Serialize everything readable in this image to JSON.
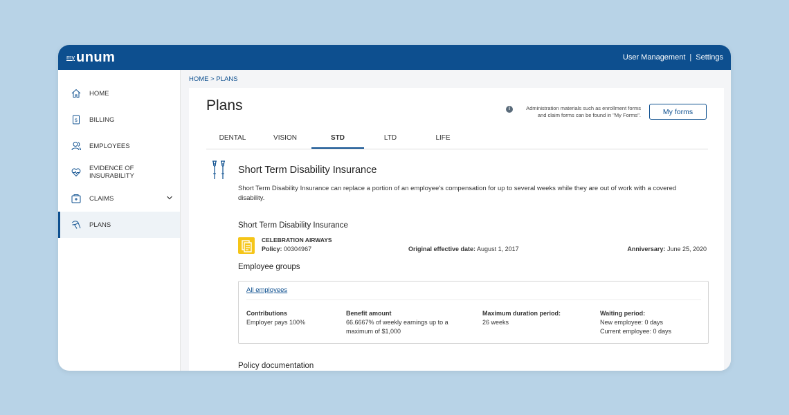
{
  "header": {
    "logo_prefix": "my",
    "logo_brand": "unum",
    "nav_user_management": "User Management",
    "nav_separator": "|",
    "nav_settings": "Settings"
  },
  "sidebar": {
    "items": [
      {
        "label": "HOME",
        "icon": "home-icon"
      },
      {
        "label": "BILLING",
        "icon": "billing-icon"
      },
      {
        "label": "EMPLOYEES",
        "icon": "employees-icon"
      },
      {
        "label": "EVIDENCE OF INSURABILITY",
        "icon": "heart-icon"
      },
      {
        "label": "CLAIMS",
        "icon": "claims-icon"
      },
      {
        "label": "PLANS",
        "icon": "plans-icon"
      }
    ],
    "active": "PLANS"
  },
  "breadcrumb": "HOME > PLANS",
  "page": {
    "title": "Plans",
    "info_note_line1": "Administration materials such as enrollment forms",
    "info_note_line2": "and claim forms  can be found in \"My Forms\".",
    "my_forms_button": "My forms",
    "tabs": [
      "DENTAL",
      "VISION",
      "STD",
      "LTD",
      "LIFE"
    ],
    "active_tab": "STD"
  },
  "plan": {
    "title": "Short Term Disability Insurance",
    "description": "Short Term Disability Insurance can replace a portion of an employee's compensation for up to several weeks while they are out of work with a covered disability.",
    "subtitle": "Short Term Disability Insurance",
    "company": "CELEBRATION AIRWAYS",
    "policy_label": "Policy:",
    "policy_number": "00304967",
    "effective_label": "Original effective date:",
    "effective_date": "August 1, 2017",
    "anniversary_label": "Anniversary:",
    "anniversary_date": "June 25, 2020"
  },
  "groups": {
    "title": "Employee groups",
    "link": "All employees",
    "columns": {
      "contributions_label": "Contributions",
      "contributions_value": "Employer pays 100%",
      "benefit_label": "Benefit amount",
      "benefit_value_1": "66.6667% of weekly earnings up to a",
      "benefit_value_2": "maximum of $1,000",
      "max_label": "Maximum duration period:",
      "max_value": "26 weeks",
      "waiting_label": "Waiting period:",
      "waiting_value_1": "New employee: 0 days",
      "waiting_value_2": "Current employee: 0 days"
    }
  },
  "documentation_title": "Policy documentation",
  "colors": {
    "brand": "#0d4f8f",
    "background": "#b8d3e7",
    "policy_icon": "#f5c518"
  }
}
